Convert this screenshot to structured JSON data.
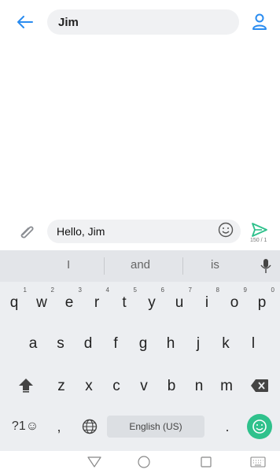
{
  "header": {
    "recipient": "Jim"
  },
  "compose": {
    "message": "Hello, Jim",
    "counter": "150 / 1"
  },
  "keyboard": {
    "suggestions": [
      "I",
      "and",
      "is"
    ],
    "row1": [
      {
        "key": "q",
        "hint": "1"
      },
      {
        "key": "w",
        "hint": "2"
      },
      {
        "key": "e",
        "hint": "3"
      },
      {
        "key": "r",
        "hint": "4"
      },
      {
        "key": "t",
        "hint": "5"
      },
      {
        "key": "y",
        "hint": "6"
      },
      {
        "key": "u",
        "hint": "7"
      },
      {
        "key": "i",
        "hint": "8"
      },
      {
        "key": "o",
        "hint": "9"
      },
      {
        "key": "p",
        "hint": "0"
      }
    ],
    "row2": [
      "a",
      "s",
      "d",
      "f",
      "g",
      "h",
      "j",
      "k",
      "l"
    ],
    "row3": [
      "z",
      "x",
      "c",
      "v",
      "b",
      "n",
      "m"
    ],
    "symbols_label": "?1☺",
    "comma": ",",
    "period": ".",
    "space_label": "English (US)"
  },
  "colors": {
    "accent": "#2a8cf0",
    "send": "#2fc18c",
    "emoji_key": "#2fc18c"
  },
  "icons": {
    "back": "back-arrow-icon",
    "contact": "person-icon",
    "attach": "paperclip-icon",
    "emoji": "smiley-icon",
    "send": "send-icon",
    "mic": "mic-icon",
    "shift": "shift-icon",
    "delete": "backspace-icon",
    "globe": "globe-icon",
    "emoji_key": "emoji-key-icon",
    "nav_back": "triangle-back-icon",
    "nav_home": "circle-home-icon",
    "nav_recent": "square-recent-icon",
    "nav_keyboard": "keyboard-icon"
  }
}
